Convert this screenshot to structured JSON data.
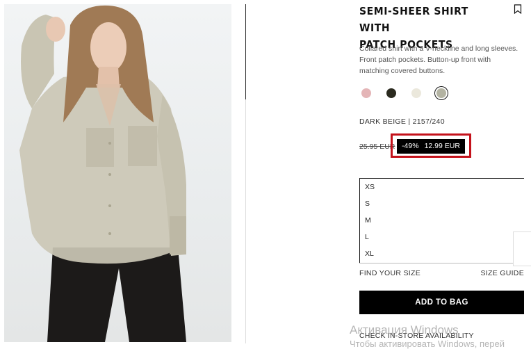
{
  "product": {
    "title_line1": "SEMI-SHEER SHIRT WITH",
    "title_line2": "PATCH POCKETS",
    "desc_line1": "Collared shirt with a V-neckline and long sleeves.",
    "desc_line2": "Front patch pockets. Button-up front with",
    "desc_line3": "matching covered buttons.",
    "color_ref": "DARK BEIGE | 2157/240",
    "old_price": "25.95 EUR",
    "discount": "-49%",
    "new_price": "12.99 EUR"
  },
  "swatches": [
    {
      "name": "pink",
      "color": "#e4b5b7"
    },
    {
      "name": "dark-olive",
      "color": "#2b2a1f"
    },
    {
      "name": "cream",
      "color": "#ebe8dc"
    },
    {
      "name": "dark-beige",
      "color": "#b3b3a2",
      "selected": true
    }
  ],
  "sizes": [
    "XS",
    "S",
    "M",
    "L",
    "XL"
  ],
  "links": {
    "find_your_size": "FIND YOUR SIZE",
    "size_guide": "SIZE GUIDE",
    "check_store": "CHECK IN-STORE AVAILABILITY"
  },
  "add_to_bag": "ADD TO BAG",
  "watermark": {
    "line1": "Активация Windows",
    "line2": "Чтобы активировать Windows, перей"
  },
  "colors": {
    "highlight": "#c4121b",
    "button": "#000000"
  }
}
